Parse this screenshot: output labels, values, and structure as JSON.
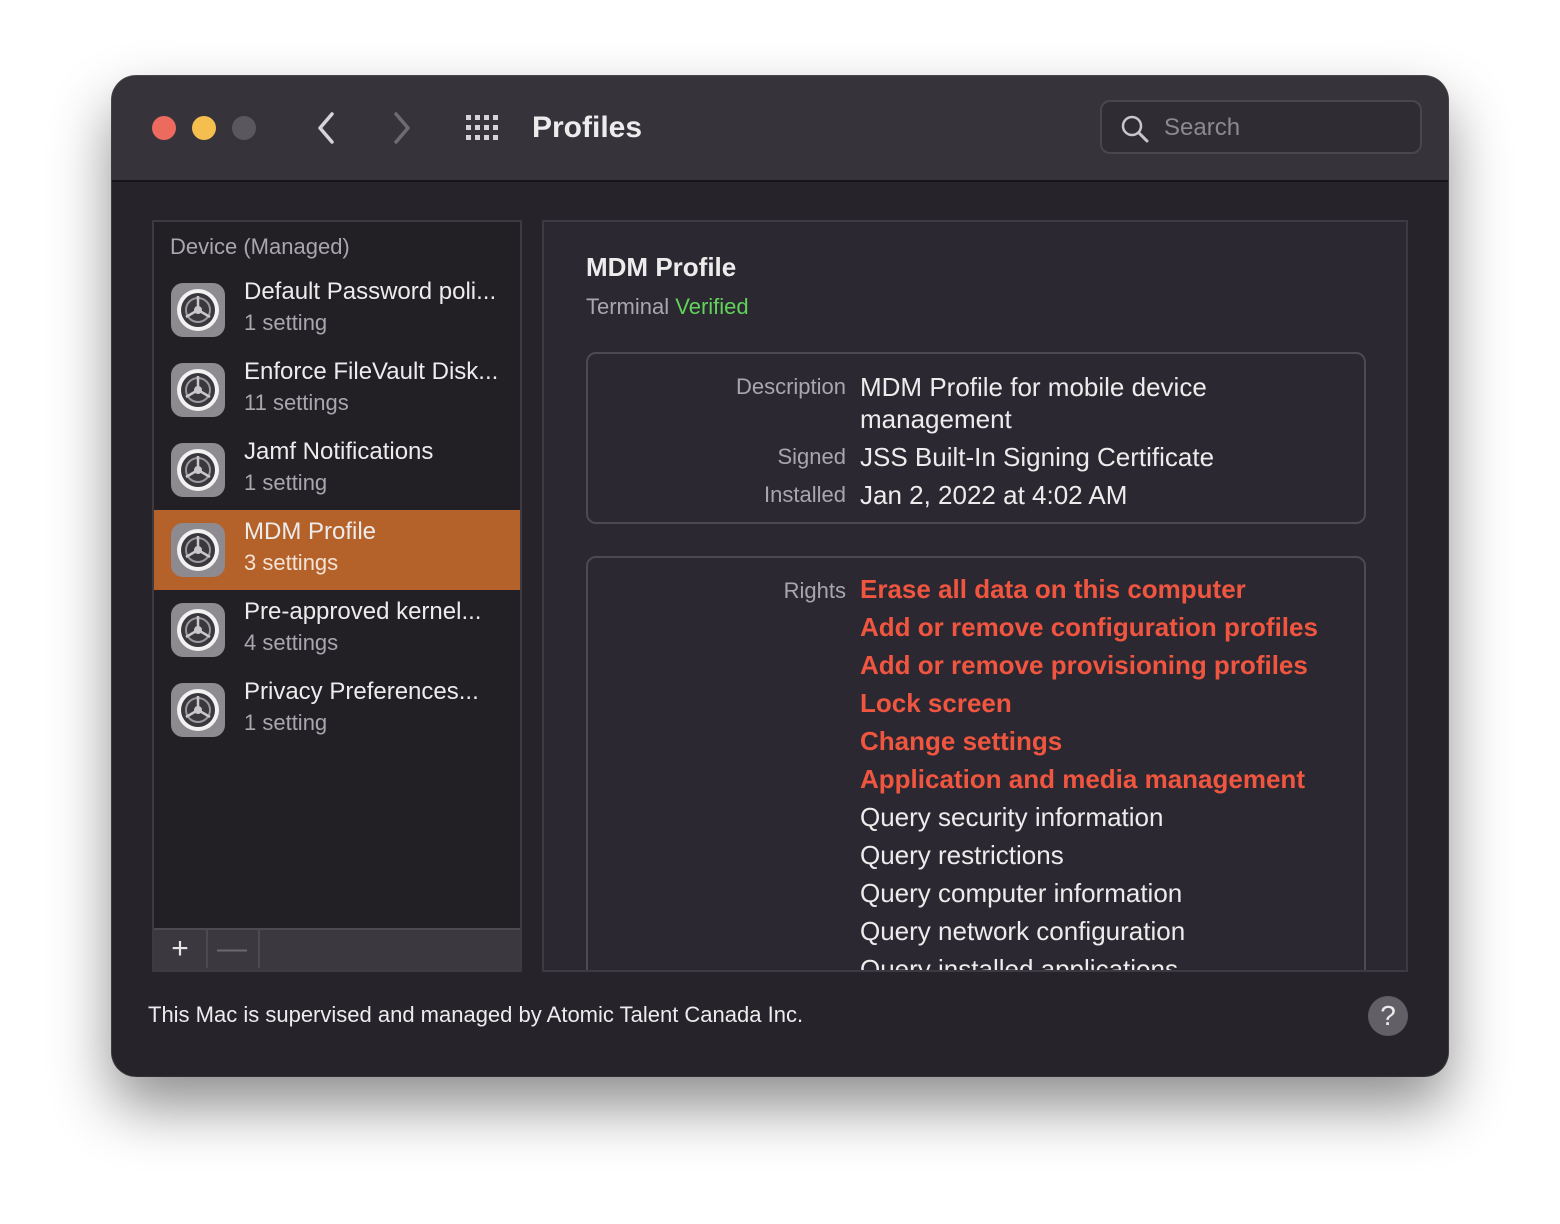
{
  "window": {
    "title": "Profiles",
    "search_placeholder": "Search"
  },
  "sidebar": {
    "header": "Device (Managed)",
    "items": [
      {
        "name": "Default Password poli...",
        "count": "1 setting"
      },
      {
        "name": "Enforce FileVault Disk...",
        "count": "11 settings"
      },
      {
        "name": "Jamf Notifications",
        "count": "1 setting"
      },
      {
        "name": "MDM Profile",
        "count": "3 settings",
        "selected": true
      },
      {
        "name": "Pre-approved kernel...",
        "count": "4 settings"
      },
      {
        "name": "Privacy Preferences...",
        "count": "1 setting"
      }
    ],
    "add_label": "+",
    "remove_label": "—"
  },
  "detail": {
    "title": "MDM Profile",
    "source": "Terminal",
    "status": "Verified",
    "info": {
      "description_label": "Description",
      "description_value": "MDM Profile for mobile device management",
      "signed_label": "Signed",
      "signed_value": "JSS Built-In Signing Certificate",
      "installed_label": "Installed",
      "installed_value": "Jan 2, 2022 at 4:02 AM"
    },
    "rights_label": "Rights",
    "rights": [
      {
        "text": "Erase all data on this computer",
        "warning": true
      },
      {
        "text": "Add or remove configuration profiles",
        "warning": true
      },
      {
        "text": "Add or remove provisioning profiles",
        "warning": true
      },
      {
        "text": "Lock screen",
        "warning": true
      },
      {
        "text": "Change settings",
        "warning": true
      },
      {
        "text": "Application and media management",
        "warning": true
      },
      {
        "text": "Query security information",
        "warning": false
      },
      {
        "text": "Query restrictions",
        "warning": false
      },
      {
        "text": "Query computer information",
        "warning": false
      },
      {
        "text": "Query network configuration",
        "warning": false
      },
      {
        "text": "Query installed applications",
        "warning": false
      }
    ]
  },
  "footer": {
    "text": "This Mac is supervised and managed by Atomic Talent Canada Inc.",
    "help_label": "?"
  },
  "colors": {
    "selection": "#b5622a",
    "verified": "#5fd35a",
    "warning": "#f0553f"
  }
}
